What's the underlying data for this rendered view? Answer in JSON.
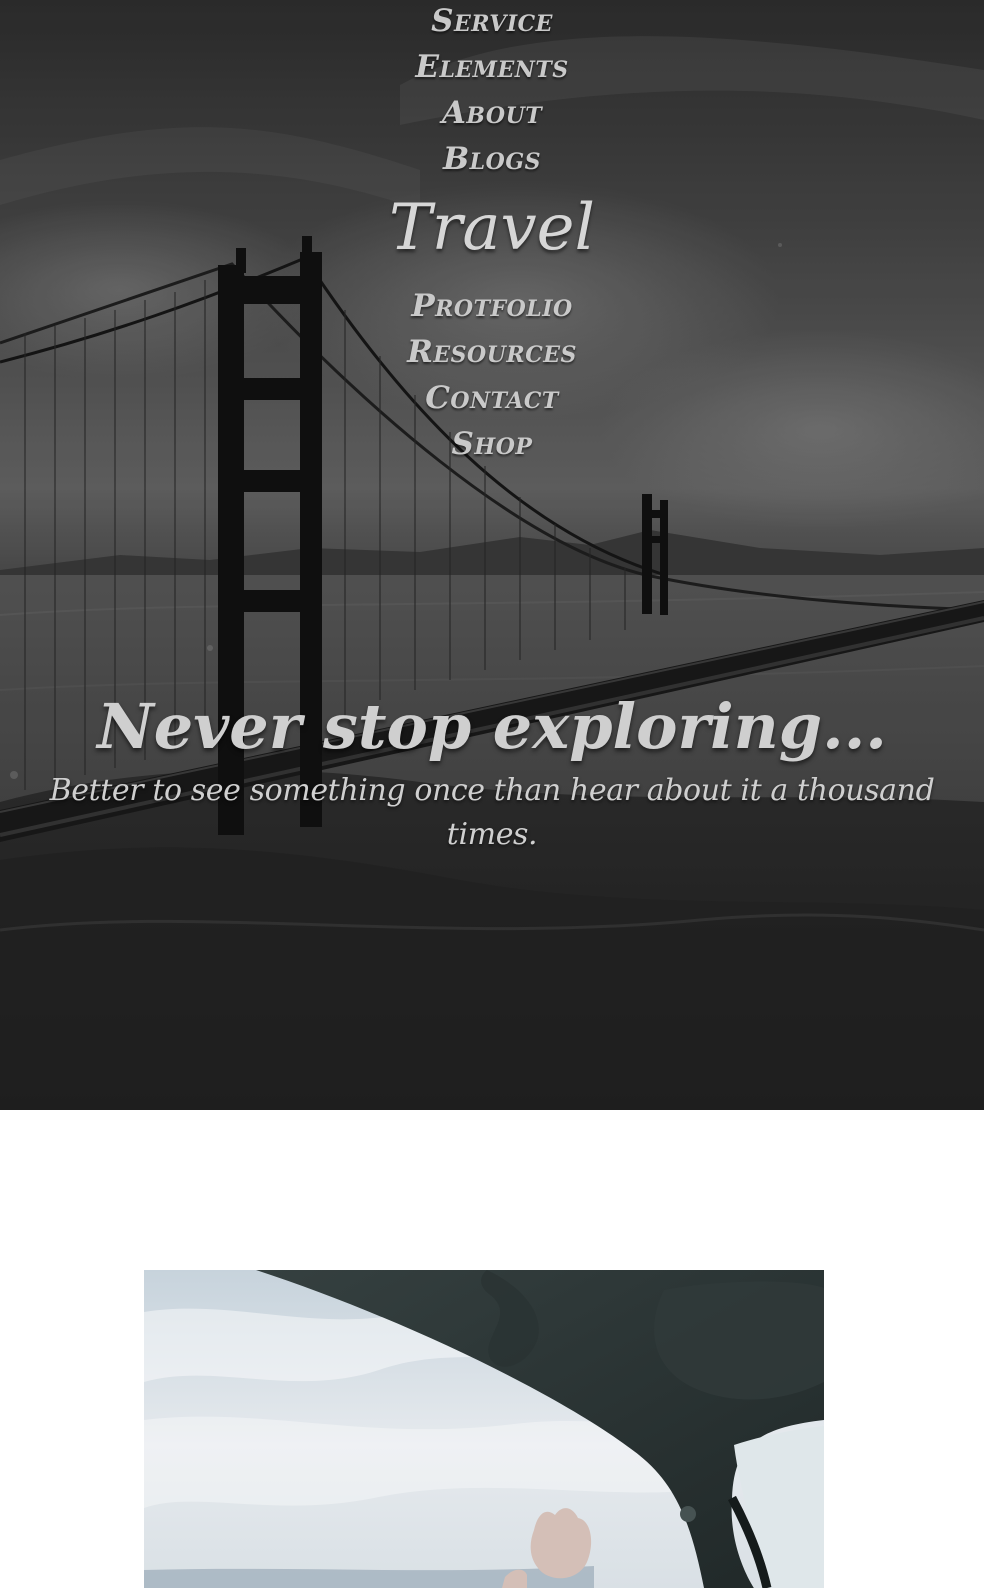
{
  "nav": {
    "items": [
      "Service",
      "Elements",
      "About",
      "Blogs",
      "Travel",
      "Protfolio",
      "Resources",
      "Contact",
      "Shop"
    ]
  },
  "hero": {
    "title": "Never stop exploring...",
    "subtitle": "Better to see something once than hear about it a thousand times."
  },
  "colors": {
    "text": "#cfcfcf",
    "overlay": "#3b3b3b",
    "page_bg": "#ffffff"
  }
}
